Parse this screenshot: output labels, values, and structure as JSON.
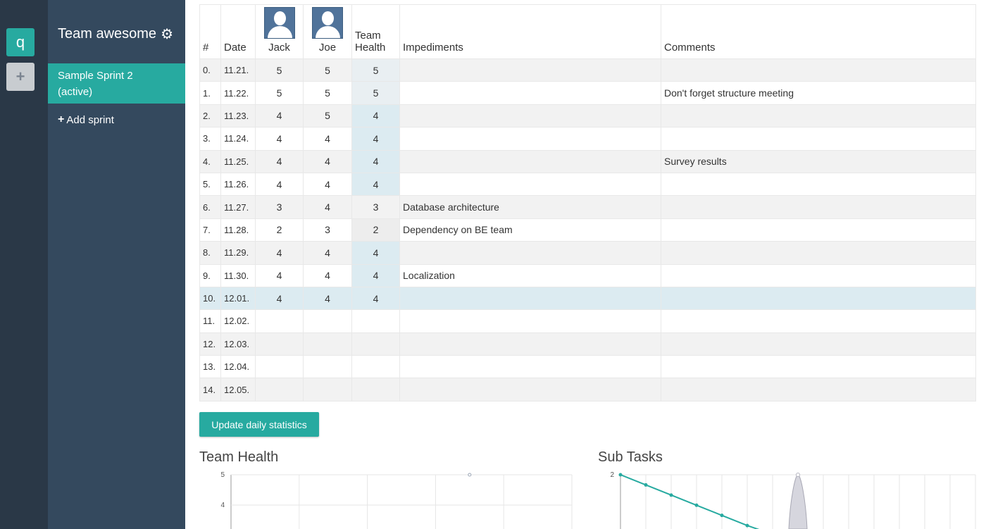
{
  "rail": {
    "brand_letter": "q",
    "add_symbol": "+"
  },
  "sidebar": {
    "team_name": "Team awesome",
    "active_sprint": {
      "name": "Sample Sprint 2",
      "status": "(active)"
    },
    "add_sprint_label": "Add sprint"
  },
  "table": {
    "headers": {
      "index": "#",
      "date": "Date",
      "member1": "Jack",
      "member2": "Joe",
      "health_line1": "Team",
      "health_line2": "Health",
      "impediments": "Impediments",
      "comments": "Comments"
    },
    "rows": [
      {
        "idx": "0.",
        "date": "11.21.",
        "jack": "5",
        "joe": "5",
        "health": "5",
        "impediment": "",
        "comment": ""
      },
      {
        "idx": "1.",
        "date": "11.22.",
        "jack": "5",
        "joe": "5",
        "health": "5",
        "impediment": "",
        "comment": "Don't forget structure meeting"
      },
      {
        "idx": "2.",
        "date": "11.23.",
        "jack": "4",
        "joe": "5",
        "health": "4",
        "impediment": "",
        "comment": ""
      },
      {
        "idx": "3.",
        "date": "11.24.",
        "jack": "4",
        "joe": "4",
        "health": "4",
        "impediment": "",
        "comment": ""
      },
      {
        "idx": "4.",
        "date": "11.25.",
        "jack": "4",
        "joe": "4",
        "health": "4",
        "impediment": "",
        "comment": "Survey results"
      },
      {
        "idx": "5.",
        "date": "11.26.",
        "jack": "4",
        "joe": "4",
        "health": "4",
        "impediment": "",
        "comment": ""
      },
      {
        "idx": "6.",
        "date": "11.27.",
        "jack": "3",
        "joe": "4",
        "health": "3",
        "impediment": "Database architecture",
        "comment": ""
      },
      {
        "idx": "7.",
        "date": "11.28.",
        "jack": "2",
        "joe": "3",
        "health": "2",
        "impediment": "Dependency on BE team",
        "comment": ""
      },
      {
        "idx": "8.",
        "date": "11.29.",
        "jack": "4",
        "joe": "4",
        "health": "4",
        "impediment": "",
        "comment": ""
      },
      {
        "idx": "9.",
        "date": "11.30.",
        "jack": "4",
        "joe": "4",
        "health": "4",
        "impediment": "Localization",
        "comment": ""
      },
      {
        "idx": "10.",
        "date": "12.01.",
        "jack": "4",
        "joe": "4",
        "health": "4",
        "impediment": "",
        "comment": ""
      },
      {
        "idx": "11.",
        "date": "12.02.",
        "jack": "",
        "joe": "",
        "health": "",
        "impediment": "",
        "comment": ""
      },
      {
        "idx": "12.",
        "date": "12.03.",
        "jack": "",
        "joe": "",
        "health": "",
        "impediment": "",
        "comment": ""
      },
      {
        "idx": "13.",
        "date": "12.04.",
        "jack": "",
        "joe": "",
        "health": "",
        "impediment": "",
        "comment": ""
      },
      {
        "idx": "14.",
        "date": "12.05.",
        "jack": "",
        "joe": "",
        "health": "",
        "impediment": "",
        "comment": ""
      }
    ]
  },
  "update_button_label": "Update daily statistics",
  "colors": {
    "accent": "#27aaa0",
    "sidebar": "#34495e",
    "rail": "#2a3847",
    "current_row": "#dcebf1"
  },
  "chart_data": [
    {
      "type": "line",
      "title": "Team Health",
      "y_ticks": [
        "5",
        "4"
      ],
      "ylim": [
        3.7,
        5.1
      ],
      "xlim": [
        0,
        5
      ],
      "series": [
        {
          "x": [
            3.5
          ],
          "values": [
            5
          ]
        }
      ],
      "grid": true
    },
    {
      "type": "line",
      "title": "Sub Tasks",
      "y_ticks": [
        "2"
      ],
      "ylim": [
        1.6,
        2.05
      ],
      "xlim": [
        0,
        14
      ],
      "series": [
        {
          "x": [
            0,
            1,
            2,
            3,
            4,
            5,
            5.5
          ],
          "values": [
            2,
            1.93,
            1.86,
            1.79,
            1.72,
            1.65,
            1.62
          ],
          "color": "#27aaa0"
        },
        {
          "x": [
            7
          ],
          "values": [
            2
          ],
          "color": "#b5b5c0"
        }
      ],
      "grid": true
    }
  ]
}
